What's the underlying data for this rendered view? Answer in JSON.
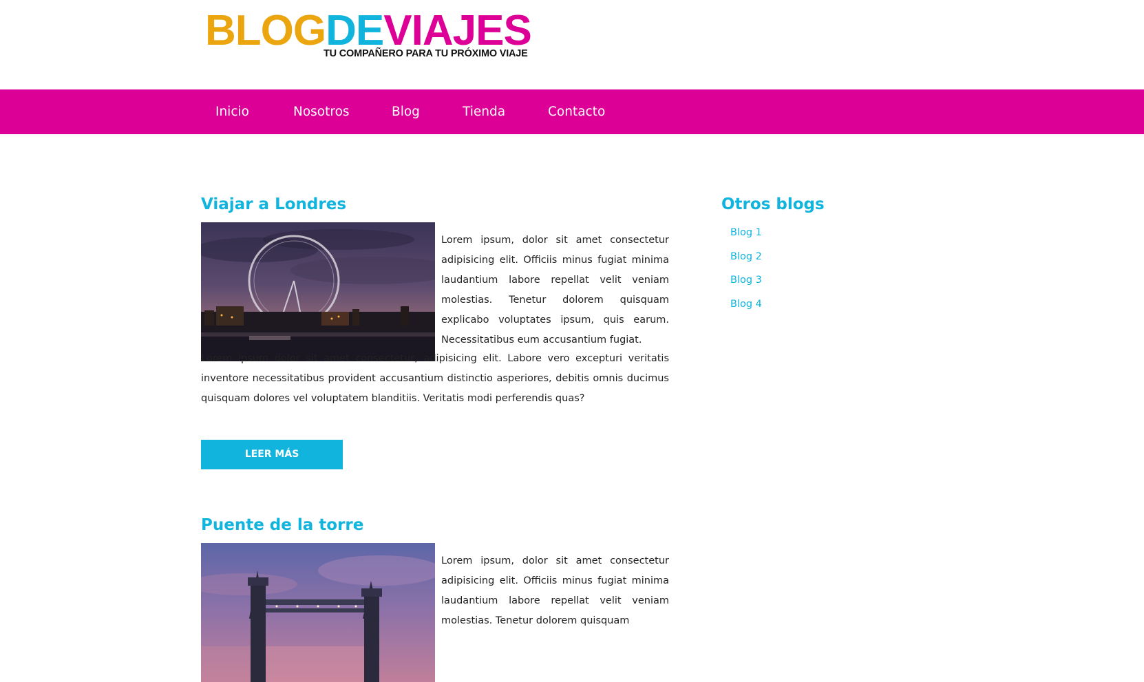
{
  "site": {
    "logo_parts": [
      "BLOG",
      "DE",
      "VIAJES"
    ],
    "tagline": "TU COMPAÑERO PARA TU PRÓXIMO VIAJE"
  },
  "colors": {
    "blog": "#eba50e",
    "de": "#11b4dd",
    "viajes": "#dd0096",
    "nav_bg": "#dd0096",
    "accent": "#11b4dd"
  },
  "nav": {
    "items": [
      {
        "label": "Inicio"
      },
      {
        "label": "Nosotros"
      },
      {
        "label": "Blog"
      },
      {
        "label": "Tienda"
      },
      {
        "label": "Contacto"
      }
    ]
  },
  "posts": [
    {
      "title": "Viajar a Londres",
      "image": "london-eye-photo",
      "intro": "Lorem ipsum, dolor sit amet consectetur adipisicing elit. Officiis minus fugiat minima laudantium labore repellat velit veniam molestias. Tenetur dolorem quisquam explicabo voluptates ipsum, quis earum. Necessitatibus eum accusantium fugiat.",
      "body": "Lorem ipsum dolor sit amet consectetur, adipisicing elit. Labore vero excepturi veritatis inventore necessitatibus provident accusantium distinctio asperiores, debitis omnis ducimus quisquam dolores vel voluptatem blanditiis. Veritatis modi perferendis quas?",
      "button": "LEER MÁS"
    },
    {
      "title": "Puente de la torre",
      "image": "tower-bridge-photo",
      "intro": "Lorem ipsum, dolor sit amet consectetur adipisicing elit. Officiis minus fugiat minima laudantium labore repellat velit veniam molestias. Tenetur dolorem quisquam"
    }
  ],
  "sidebar": {
    "title": "Otros blogs",
    "links": [
      "Blog 1",
      "Blog 2",
      "Blog 3",
      "Blog 4"
    ]
  }
}
